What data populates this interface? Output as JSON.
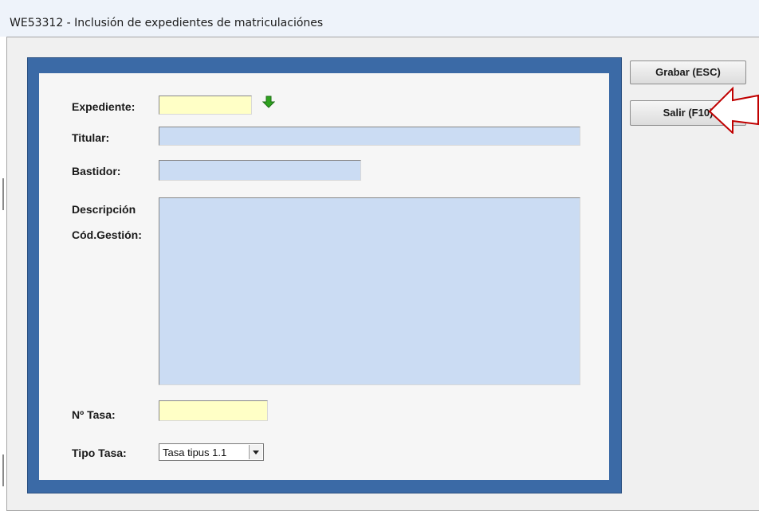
{
  "window": {
    "title": "WE53312 - Inclusión de expedientes de matriculaciónes"
  },
  "form": {
    "expediente": {
      "label": "Expediente:",
      "value": ""
    },
    "titular": {
      "label": "Titular:",
      "value": ""
    },
    "bastidor": {
      "label": "Bastidor:",
      "value": ""
    },
    "descripcion": {
      "label_line1": "Descripción",
      "label_line2": "Cód.Gestión:",
      "value": ""
    },
    "num_tasa": {
      "label": "Nº Tasa:",
      "value": ""
    },
    "tipo_tasa": {
      "label": "Tipo Tasa:",
      "selected": "Tasa tipus 1.1"
    }
  },
  "buttons": {
    "save_label": "Grabar (ESC)",
    "exit_label": "Salir (F10)"
  },
  "icons": {
    "lookup": "green-down-arrow-icon",
    "dropdown": "chevron-down-icon",
    "annotation": "red-pointer-arrow-icon"
  },
  "colors": {
    "frame": "#3b6aa6",
    "required_field": "#ffffc6",
    "readonly_field": "#cbdcf3",
    "lookup_arrow": "#2fa21f",
    "annotation_arrow": "#c00000"
  }
}
